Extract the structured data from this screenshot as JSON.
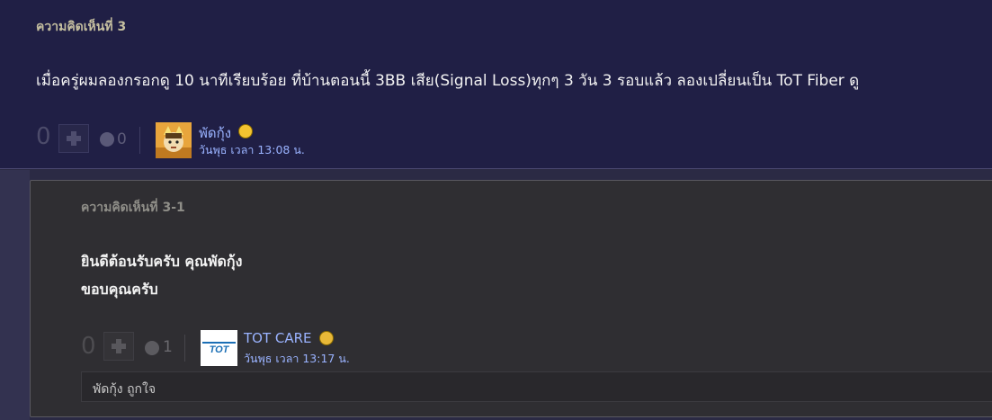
{
  "comment": {
    "number_label": "ความคิดเห็นที่ 3",
    "body": "เมื่อครู่ผมลองกรอกดู 10 นาทีเรียบร้อย  ที่บ้านตอนนี้ 3BB เสีย(Signal Loss)ทุกๆ 3 วัน   3 รอบแล้ว ลองเปลี่ยนเป็น ToT Fiber ดู",
    "vote_count": "0",
    "emotion_count": "0",
    "author": {
      "name": "พัดกุ้ง",
      "date": "วันพุธ เวลา 13:08 น.",
      "emoticon": "laughing-emoji-icon"
    }
  },
  "reply": {
    "number_label": "ความคิดเห็นที่ 3-1",
    "body_lines": [
      "ยินดีต้อนรับครับ คุณพัดกุ้ง",
      "ขอบคุณครับ"
    ],
    "vote_count": "0",
    "emotion_count": "1",
    "author": {
      "name": "TOT CARE",
      "date": "วันพุธ เวลา 13:17 น.",
      "emoticon": "grinning-face-icon",
      "avatar_text": "TOT"
    },
    "likes": "พัดกุ้ง ถูกใจ"
  },
  "colors": {
    "main_bg": "#201f45",
    "reply_bg": "#2f2e32",
    "author_link": "#9ab3ff",
    "label_gold": "#c5bfa0"
  }
}
